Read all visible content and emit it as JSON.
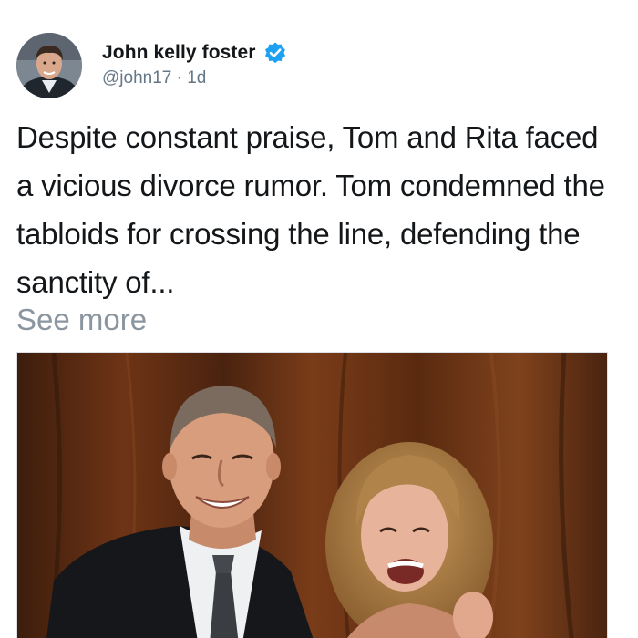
{
  "author": {
    "name": "John kelly foster",
    "handle": "@john17",
    "separator": "·",
    "age": "1d",
    "verified": true,
    "avatar_icon": "profile-photo"
  },
  "post": {
    "text": "Despite constant praise, Tom and Rita faced a vicious divorce rumor. Tom condemned the tabloids for crossing the line, defending the sanctity of...",
    "see_more_label": "See more",
    "image_icon": "couple-photo"
  },
  "colors": {
    "text": "#14171a",
    "secondary": "#657786",
    "see_more": "#8b95a0",
    "verified_badge": "#1da1f2"
  }
}
